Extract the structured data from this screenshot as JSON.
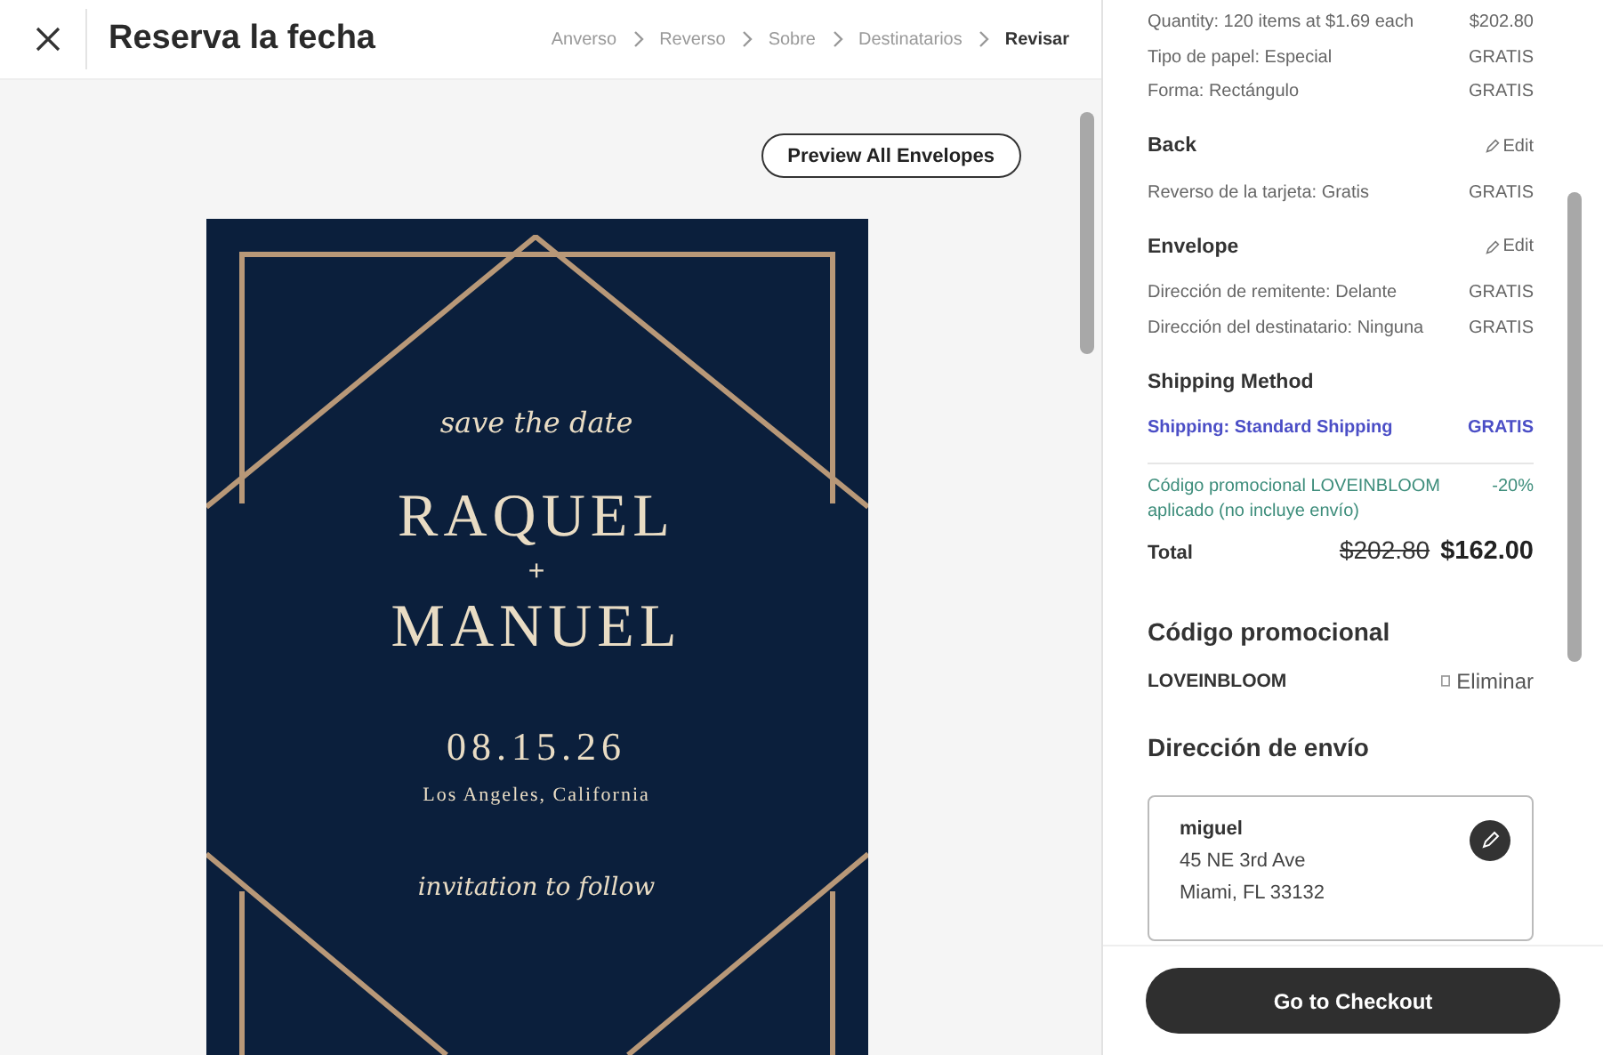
{
  "header": {
    "title": "Reserva la fecha",
    "steps": [
      {
        "label": "Anverso",
        "selected": false
      },
      {
        "label": "Reverso",
        "selected": false
      },
      {
        "label": "Sobre",
        "selected": false
      },
      {
        "label": "Destinatarios",
        "selected": false
      },
      {
        "label": "Revisar",
        "selected": true
      }
    ]
  },
  "preview": {
    "button": "Preview All Envelopes",
    "card": {
      "top_script": "save the date",
      "name_1": "RAQUEL",
      "joiner": "+",
      "name_2": "MANUEL",
      "date": "08.15.26",
      "location": "Los Angeles, California",
      "bottom_script": "invitation to follow"
    }
  },
  "summary": {
    "lines": [
      {
        "label": "Quantity: 120 items at $1.69 each",
        "value": "$202.80"
      },
      {
        "label": "Tipo de papel: Especial",
        "value": "GRATIS"
      },
      {
        "label": "Forma: Rectángulo",
        "value": "GRATIS"
      }
    ],
    "sections": [
      {
        "title": "Back",
        "edit": "Edit",
        "lines": [
          {
            "label": "Reverso de la tarjeta: Gratis",
            "value": "GRATIS"
          }
        ]
      },
      {
        "title": "Envelope",
        "edit": "Edit",
        "lines": [
          {
            "label": "Dirección de remitente: Delante",
            "value": "GRATIS"
          },
          {
            "label": "Dirección del destinatario: Ninguna",
            "value": "GRATIS"
          }
        ]
      }
    ],
    "shipping": {
      "title": "Shipping Method",
      "label": "Shipping: Standard Shipping",
      "value": "GRATIS"
    },
    "promo_line": {
      "label": "Código promocional LOVEINBLOOM aplicado (no incluye envío)",
      "value": "-20%"
    },
    "total": {
      "label": "Total",
      "old": "$202.80",
      "new": "$162.00"
    },
    "promo": {
      "title": "Código promocional",
      "code": "LOVEINBLOOM",
      "remove": "Eliminar"
    },
    "address": {
      "title": "Dirección de envío",
      "name": "miguel",
      "line_1": "45 NE 3rd Ave",
      "line_2": "Miami, FL 33132"
    }
  },
  "checkout": "Go to Checkout"
}
